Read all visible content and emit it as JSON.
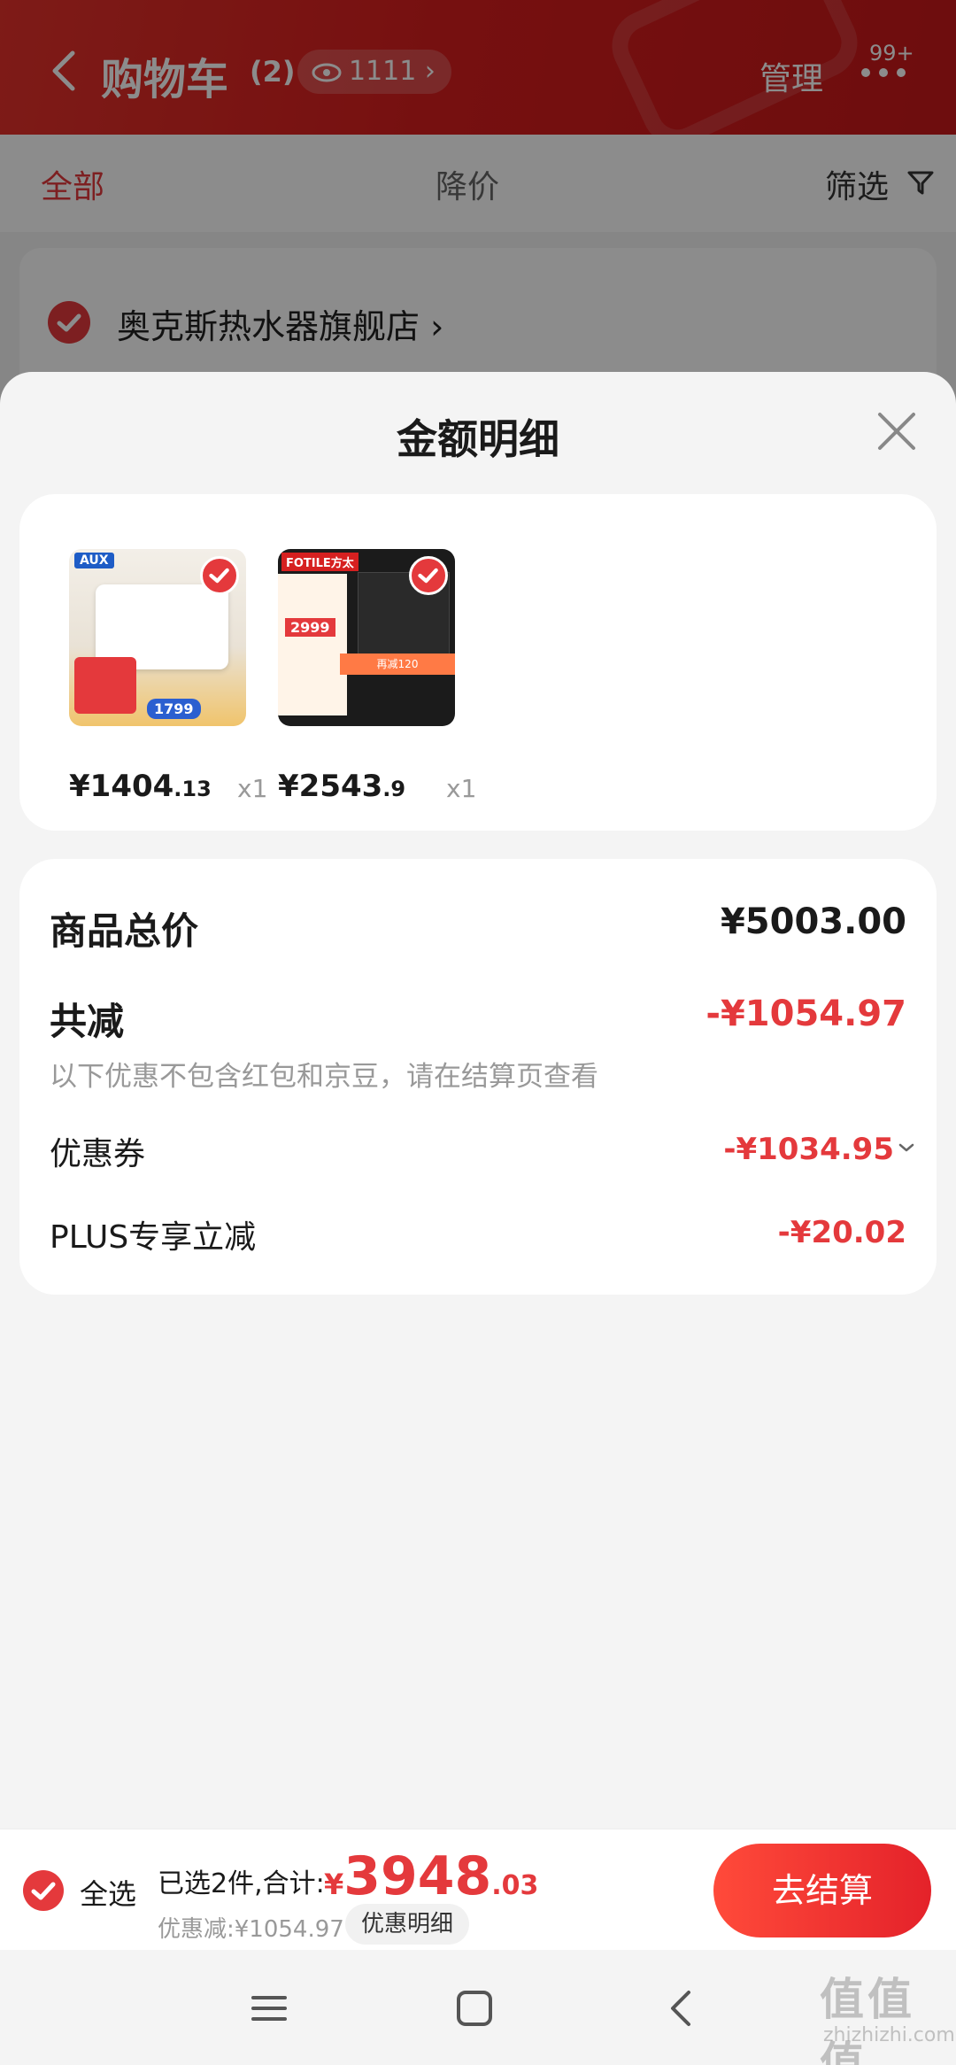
{
  "header": {
    "title": "购物车",
    "count": "(2)",
    "watch_count": "1111",
    "manage": "管理",
    "badge": "99+"
  },
  "tabs": {
    "all": "全部",
    "price_drop": "降价",
    "filter": "筛选"
  },
  "shop": {
    "name": "奥克斯热水器旗舰店"
  },
  "sheet": {
    "title": "金额明细",
    "products": [
      {
        "price_int": "¥1404",
        "price_dec": ".13",
        "qty": "x1"
      },
      {
        "price_int": "¥2543",
        "price_dec": ".9",
        "qty": "x1"
      }
    ],
    "thumb1": {
      "brand": "AUX",
      "tag": "1799"
    },
    "thumb2": {
      "brand": "FOTILE方太",
      "tag": "2999",
      "strip": "再减120"
    },
    "summary": {
      "total_label": "商品总价",
      "total_value": "¥5003.00",
      "reduce_label": "共减",
      "reduce_value": "-¥1054.97",
      "note": "以下优惠不包含红包和京豆，请在结算页查看",
      "coupon_label": "优惠券",
      "coupon_value": "-¥1034.95",
      "plus_label": "PLUS专享立减",
      "plus_value": "-¥20.02"
    }
  },
  "bottom": {
    "select_all": "全选",
    "selected": "已选2件,合计:",
    "yen": "¥",
    "total_int": "3948",
    "total_dec": ".03",
    "discount": "优惠减:¥1054.97",
    "detail": "优惠明细",
    "checkout": "去结算"
  },
  "watermark": {
    "main": "值值值",
    "sub": "zhizhizhi.com"
  },
  "colors": {
    "accent": "#e4393c",
    "header": "#d81e1e"
  }
}
